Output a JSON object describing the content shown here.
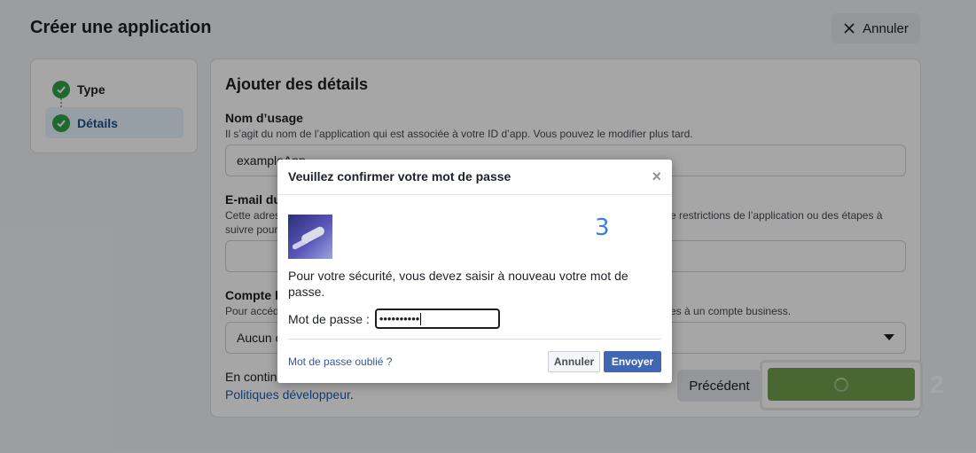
{
  "header": {
    "title": "Créer une application",
    "cancel_label": "Annuler"
  },
  "steps": [
    {
      "label": "Type",
      "done": true
    },
    {
      "label": "Détails",
      "done": true,
      "active": true
    }
  ],
  "form": {
    "title": "Ajouter des détails",
    "app_name": {
      "label": "Nom d’usage",
      "hint": "Il s’agit du nom de l’application qui est associée à votre ID d’app. Vous pouvez le modifier plus tard.",
      "value": "exampleApp"
    },
    "email": {
      "label": "E-mail du",
      "hint": "Cette adres",
      "hint_right": "e restrictions de l’application ou des étapes à",
      "hint_line2": "suivre pour",
      "value": ""
    },
    "business": {
      "label": "Compte b",
      "hint": "Pour accéd",
      "hint_right": "es à un compte business.",
      "value": "Aucun c"
    },
    "consent_text": "En contin",
    "consent_link": "Politiques développeur",
    "consent_end": ".",
    "prev_label": "Précédent"
  },
  "annotations": {
    "badge_next": "2",
    "badge_dialog": "3"
  },
  "dialog": {
    "title": "Veuillez confirmer votre mot de passe",
    "close_glyph": "×",
    "message": "Pour votre sécurité, vous devez saisir à nouveau votre mot de passe.",
    "password_label": "Mot de passe :",
    "password_value": "••••••••••",
    "forgot_label": "Mot de passe oublié ?",
    "cancel_label": "Annuler",
    "submit_label": "Envoyer"
  },
  "colors": {
    "accent_blue": "#4267b2",
    "success_green": "#31a24c",
    "next_button_green": "#6f9f4c"
  }
}
